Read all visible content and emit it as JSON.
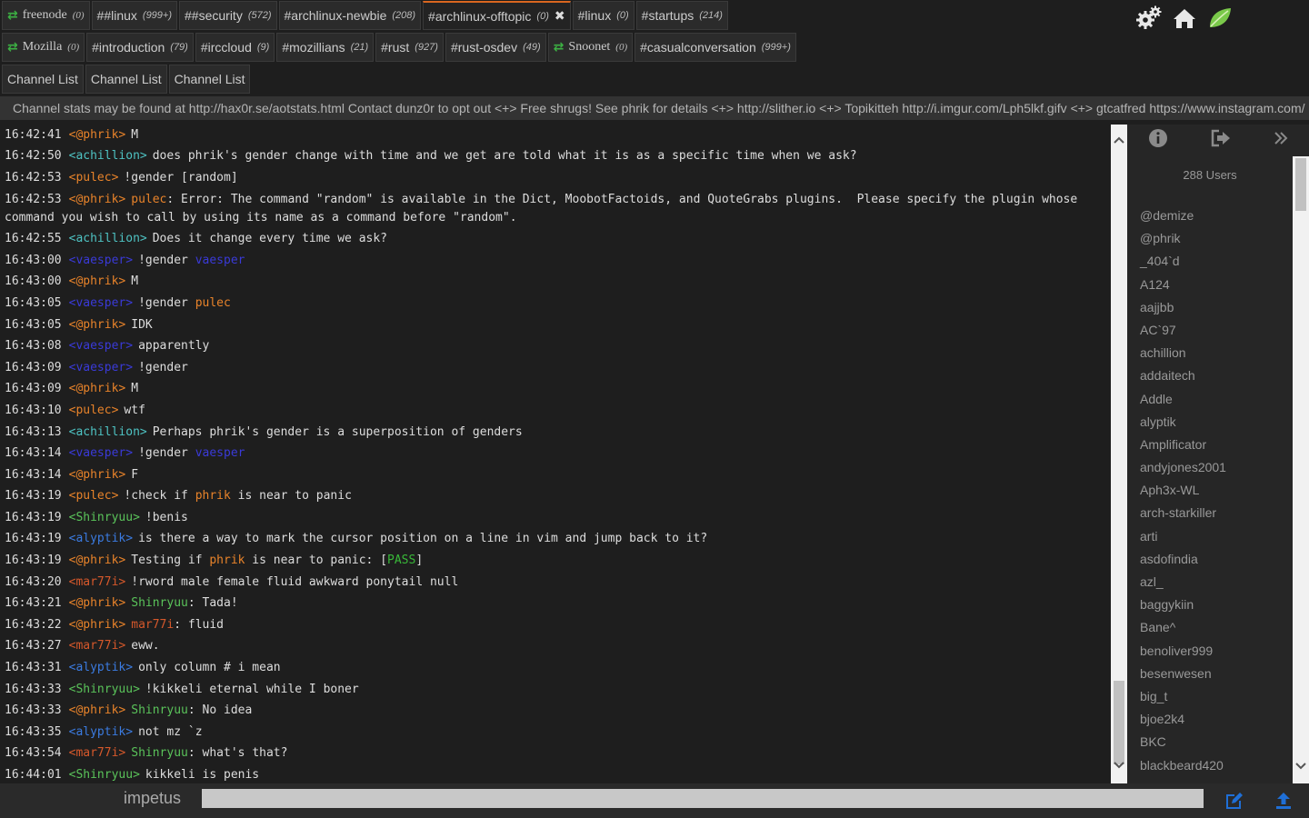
{
  "tabs": {
    "row1": [
      {
        "label": "freenode",
        "count": "(0)",
        "network": true
      },
      {
        "label": "##linux",
        "count": "(999+)"
      },
      {
        "label": "##security",
        "count": "(572)"
      },
      {
        "label": "#archlinux-newbie",
        "count": "(208)"
      },
      {
        "label": "#archlinux-offtopic",
        "count": "(0)",
        "active": true,
        "close": "✖"
      },
      {
        "label": "#linux",
        "count": "(0)"
      },
      {
        "label": "#startups",
        "count": "(214)"
      }
    ],
    "row2": [
      {
        "label": "Mozilla",
        "count": "(0)",
        "network": true
      },
      {
        "label": "#introduction",
        "count": "(79)"
      },
      {
        "label": "#irccloud",
        "count": "(9)"
      },
      {
        "label": "#mozillians",
        "count": "(21)"
      },
      {
        "label": "#rust",
        "count": "(927)"
      },
      {
        "label": "#rust-osdev",
        "count": "(49)"
      },
      {
        "label": "Snoonet",
        "count": "(0)",
        "network": true
      },
      {
        "label": "#casualconversation",
        "count": "(999+)"
      }
    ],
    "row3": [
      {
        "label": "Channel List"
      },
      {
        "label": "Channel List"
      },
      {
        "label": "Channel List"
      }
    ]
  },
  "top_icons": [
    "settings-gears-icon",
    "home-icon",
    "leaf-logo-icon"
  ],
  "topic": "Channel stats may be found at http://hax0r.se/aotstats.html Contact dunz0r to opt out <+> Free shrugs! See phrik for details <+> http://slither.io <+> Topikitteh http://i.imgur.com/Lph5lkf.gifv <+> gtcatfred https://www.instagram.com/",
  "messages": [
    {
      "time": "16:42:41",
      "nick": "<@phrik>",
      "color": "phrik",
      "parts": [
        {
          "t": "M"
        }
      ]
    },
    {
      "time": "16:42:50",
      "nick": "<achillion>",
      "color": "achillion",
      "parts": [
        {
          "t": "does phrik's gender change with time and we get are told what it is as a specific time when we ask?"
        }
      ]
    },
    {
      "time": "16:42:53",
      "nick": "<pulec>",
      "color": "pulec",
      "parts": [
        {
          "t": "!gender [random]"
        }
      ]
    },
    {
      "time": "16:42:53",
      "nick": "<@phrik>",
      "color": "phrik",
      "parts": [
        {
          "t": "pulec",
          "c": "pulec"
        },
        {
          "t": ": Error: The command \"random\" is available in the Dict, MoobotFactoids, and QuoteGrabs plugins.  Please specify the plugin whose command you wish to call by using its name as a command before \"random\"."
        }
      ]
    },
    {
      "time": "16:42:55",
      "nick": "<achillion>",
      "color": "achillion",
      "parts": [
        {
          "t": "Does it change every time we ask?"
        }
      ]
    },
    {
      "time": "16:43:00",
      "nick": "<vaesper>",
      "color": "vaesper",
      "parts": [
        {
          "t": "!gender "
        },
        {
          "t": "vaesper",
          "c": "vaesper"
        }
      ]
    },
    {
      "time": "16:43:00",
      "nick": "<@phrik>",
      "color": "phrik",
      "parts": [
        {
          "t": "M"
        }
      ]
    },
    {
      "time": "16:43:05",
      "nick": "<vaesper>",
      "color": "vaesper",
      "parts": [
        {
          "t": "!gender "
        },
        {
          "t": "pulec",
          "c": "pulec"
        }
      ]
    },
    {
      "time": "16:43:05",
      "nick": "<@phrik>",
      "color": "phrik",
      "parts": [
        {
          "t": "IDK"
        }
      ]
    },
    {
      "time": "16:43:08",
      "nick": "<vaesper>",
      "color": "vaesper",
      "parts": [
        {
          "t": "apparently"
        }
      ]
    },
    {
      "time": "16:43:09",
      "nick": "<vaesper>",
      "color": "vaesper",
      "parts": [
        {
          "t": "!gender"
        }
      ]
    },
    {
      "time": "16:43:09",
      "nick": "<@phrik>",
      "color": "phrik",
      "parts": [
        {
          "t": "M"
        }
      ]
    },
    {
      "time": "16:43:10",
      "nick": "<pulec>",
      "color": "pulec",
      "parts": [
        {
          "t": "wtf"
        }
      ]
    },
    {
      "time": "16:43:13",
      "nick": "<achillion>",
      "color": "achillion",
      "parts": [
        {
          "t": "Perhaps phrik's gender is a superposition of genders"
        }
      ]
    },
    {
      "time": "16:43:14",
      "nick": "<vaesper>",
      "color": "vaesper",
      "parts": [
        {
          "t": "!gender "
        },
        {
          "t": "vaesper",
          "c": "vaesper"
        }
      ]
    },
    {
      "time": "16:43:14",
      "nick": "<@phrik>",
      "color": "phrik",
      "parts": [
        {
          "t": "F"
        }
      ]
    },
    {
      "time": "16:43:19",
      "nick": "<pulec>",
      "color": "pulec",
      "parts": [
        {
          "t": "!check if "
        },
        {
          "t": "phrik",
          "c": "phrik"
        },
        {
          "t": " is near to panic"
        }
      ]
    },
    {
      "time": "16:43:19",
      "nick": "<Shinryuu>",
      "color": "shinryuu",
      "parts": [
        {
          "t": "!benis"
        }
      ]
    },
    {
      "time": "16:43:19",
      "nick": "<alyptik>",
      "color": "alyptik",
      "parts": [
        {
          "t": "is there a way to mark the cursor position on a line in vim and jump back to it?"
        }
      ]
    },
    {
      "time": "16:43:19",
      "nick": "<@phrik>",
      "color": "phrik",
      "parts": [
        {
          "t": "Testing if "
        },
        {
          "t": "phrik",
          "c": "phrik"
        },
        {
          "t": " is near to panic: ["
        },
        {
          "t": "PASS",
          "c": "green"
        },
        {
          "t": "]"
        }
      ]
    },
    {
      "time": "16:43:20",
      "nick": "<mar77i>",
      "color": "mar77i",
      "parts": [
        {
          "t": "!rword male female fluid awkward ponytail null"
        }
      ]
    },
    {
      "time": "16:43:21",
      "nick": "<@phrik>",
      "color": "phrik",
      "parts": [
        {
          "t": "Shinryuu",
          "c": "shinryuu"
        },
        {
          "t": ": Tada!"
        }
      ]
    },
    {
      "time": "16:43:22",
      "nick": "<@phrik>",
      "color": "phrik",
      "parts": [
        {
          "t": "mar77i",
          "c": "mar77i"
        },
        {
          "t": ": fluid"
        }
      ]
    },
    {
      "time": "16:43:27",
      "nick": "<mar77i>",
      "color": "mar77i",
      "parts": [
        {
          "t": "eww."
        }
      ]
    },
    {
      "time": "16:43:31",
      "nick": "<alyptik>",
      "color": "alyptik",
      "parts": [
        {
          "t": "only column # i mean"
        }
      ]
    },
    {
      "time": "16:43:33",
      "nick": "<Shinryuu>",
      "color": "shinryuu",
      "parts": [
        {
          "t": "!kikkeli eternal while I boner"
        }
      ]
    },
    {
      "time": "16:43:33",
      "nick": "<@phrik>",
      "color": "phrik",
      "parts": [
        {
          "t": "Shinryuu",
          "c": "shinryuu"
        },
        {
          "t": ": No idea"
        }
      ]
    },
    {
      "time": "16:43:35",
      "nick": "<alyptik>",
      "color": "alyptik",
      "parts": [
        {
          "t": "not mz `z"
        }
      ]
    },
    {
      "time": "16:43:54",
      "nick": "<mar77i>",
      "color": "mar77i",
      "parts": [
        {
          "t": "Shinryuu",
          "c": "shinryuu"
        },
        {
          "t": ": what's that?"
        }
      ]
    },
    {
      "time": "16:44:01",
      "nick": "<Shinryuu>",
      "color": "shinryuu",
      "parts": [
        {
          "t": "kikkeli is penis"
        }
      ]
    }
  ],
  "sidebar": {
    "user_count": "288 Users",
    "icons": [
      "info-icon",
      "leave-icon",
      "collapse-icon"
    ],
    "users": [
      "@demize",
      "@phrik",
      "_404`d",
      "A124",
      "aajjbb",
      "AC`97",
      "achillion",
      "addaitech",
      "Addle",
      "alyptik",
      "Amplificator",
      "andyjones2001",
      "Aph3x-WL",
      "arch-starkiller",
      "arti",
      "asdofindia",
      "azl_",
      "baggykiin",
      "Bane^",
      "benoliver999",
      "besenwesen",
      "big_t",
      "bjoe2k4",
      "BKC",
      "blackbeard420"
    ]
  },
  "input": {
    "nick": "impetus",
    "value": "",
    "placeholder": ""
  },
  "colors": {
    "accent": "#d9661f",
    "network_icon": "#3cb043",
    "bottom_icons": "#1f6fd6"
  }
}
